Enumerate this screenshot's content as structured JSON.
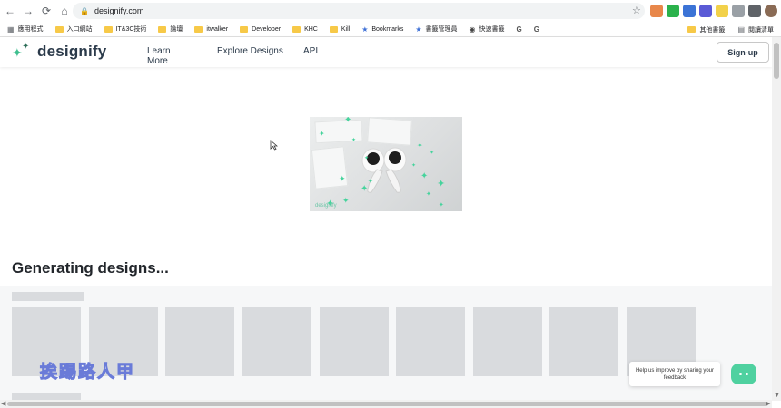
{
  "browser": {
    "url": "designify.com",
    "bookmarks": [
      "應用程式",
      "入口網站",
      "IT&3C技術",
      "論壇",
      "itwalker",
      "Developer",
      "KHC",
      "Kill",
      "Bookmarks",
      "書籤管理員",
      "快速書籤"
    ],
    "bookmarks_right": [
      "其他書籤",
      "閱讀清單"
    ]
  },
  "site": {
    "logo_text": "designify",
    "nav": {
      "learn_more": "Learn More",
      "explore_designs": "Explore Designs",
      "api": "API"
    },
    "signup_label": "Sign-up"
  },
  "main": {
    "heading": "Generating designs...",
    "hero_watermark": "designify",
    "skeleton_cards": 9
  },
  "overlay": {
    "stamp_text": "挨踢路人甲"
  },
  "feedback": {
    "text": "Help us improve by sharing your feedback"
  },
  "colors": {
    "brand_green": "#3fbf8f",
    "brand_dark": "#2b3a4a",
    "skeleton": "#d9dbde"
  }
}
